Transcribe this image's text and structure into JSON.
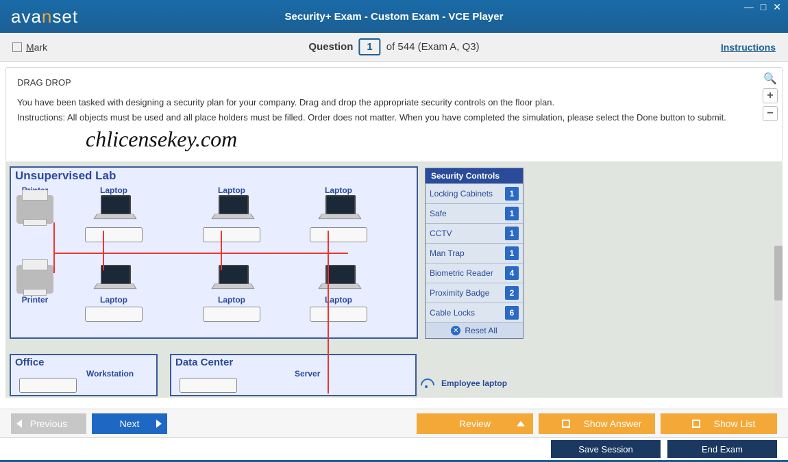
{
  "header": {
    "logo_part1": "ava",
    "logo_n": "n",
    "logo_part2": "set",
    "title": "Security+ Exam - Custom Exam - VCE Player"
  },
  "question_bar": {
    "mark_label": "Mark",
    "question_label": "Question",
    "question_number": "1",
    "of_text": "of 544 (Exam A, Q3)",
    "instructions_link": "Instructions"
  },
  "question": {
    "heading": "DRAG DROP",
    "line1": "You have been tasked with designing a security plan for your company. Drag and drop the appropriate security controls on the floor plan.",
    "line2": "Instructions: All objects must be used and all place holders must be filled. Order does not matter. When you have completed the simulation, please select the Done button to submit.",
    "watermark": "chlicensekey.com"
  },
  "simulation": {
    "lab_title": "Unsupervised Lab",
    "printer_label": "Printer",
    "laptop_label": "Laptop",
    "office_title": "Office",
    "workstation_label": "Workstation",
    "datacenter_title": "Data Center",
    "server_label": "Server",
    "employee_label": "Employee laptop",
    "security_panel": {
      "header": "Security Controls",
      "items": [
        {
          "label": "Locking Cabinets",
          "count": "1"
        },
        {
          "label": "Safe",
          "count": "1"
        },
        {
          "label": "CCTV",
          "count": "1"
        },
        {
          "label": "Man Trap",
          "count": "1"
        },
        {
          "label": "Biometric Reader",
          "count": "4"
        },
        {
          "label": "Proximity Badge",
          "count": "2"
        },
        {
          "label": "Cable Locks",
          "count": "6"
        }
      ],
      "reset_label": "Reset All"
    }
  },
  "nav": {
    "previous": "Previous",
    "next": "Next",
    "review": "Review",
    "show_answer": "Show Answer",
    "show_list": "Show List",
    "save_session": "Save Session",
    "end_exam": "End Exam"
  }
}
